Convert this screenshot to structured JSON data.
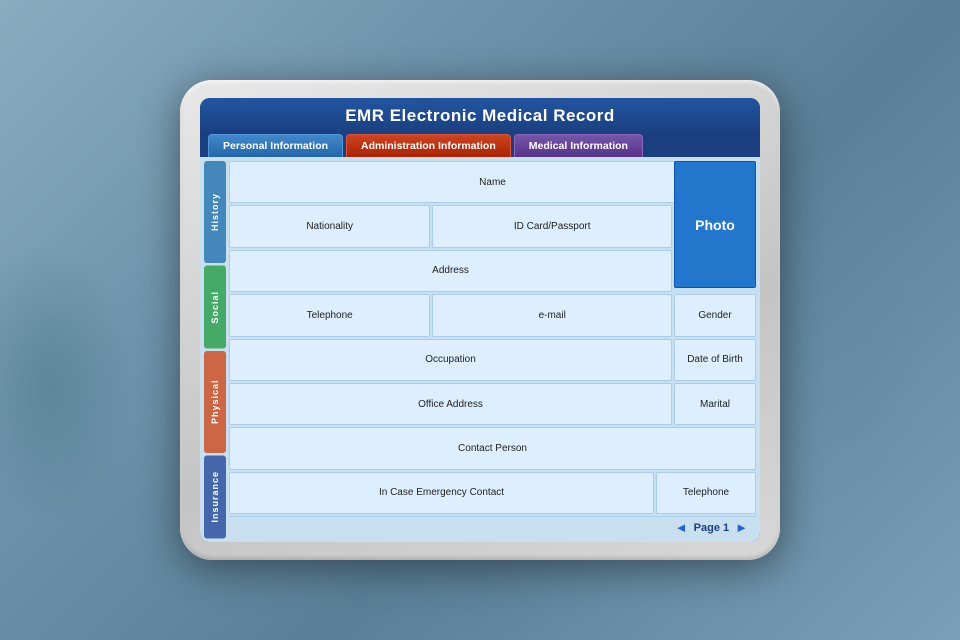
{
  "title": "EMR Electronic Medical Record",
  "tabs": [
    {
      "id": "personal",
      "label": "Personal Information",
      "active": false
    },
    {
      "id": "admin",
      "label": "Administration Information",
      "active": true
    },
    {
      "id": "medical",
      "label": "Medical  Information",
      "active": false
    }
  ],
  "sidebar": {
    "sections": [
      {
        "id": "history",
        "label": "History",
        "color": "#4488bb"
      },
      {
        "id": "social",
        "label": "Social",
        "color": "#44aa66"
      },
      {
        "id": "physical",
        "label": "Physical",
        "color": "#cc6644"
      },
      {
        "id": "insurance",
        "label": "Insurance",
        "color": "#4466aa"
      }
    ]
  },
  "form": {
    "photo_label": "Photo",
    "fields": {
      "name": "Name",
      "nationality": "Nationality",
      "id_card": "ID Card/Passport",
      "address": "Address",
      "telephone": "Telephone",
      "email": "e-mail",
      "gender": "Gender",
      "occupation": "Occupation",
      "date_of_birth": "Date of Birth",
      "office_address": "Office Address",
      "marital": "Marital",
      "contact_person": "Contact Person",
      "emergency_contact": "In Case Emergency Contact",
      "emergency_telephone": "Telephone"
    }
  },
  "pagination": {
    "label": "Page 1",
    "prev": "◄",
    "next": "►"
  }
}
